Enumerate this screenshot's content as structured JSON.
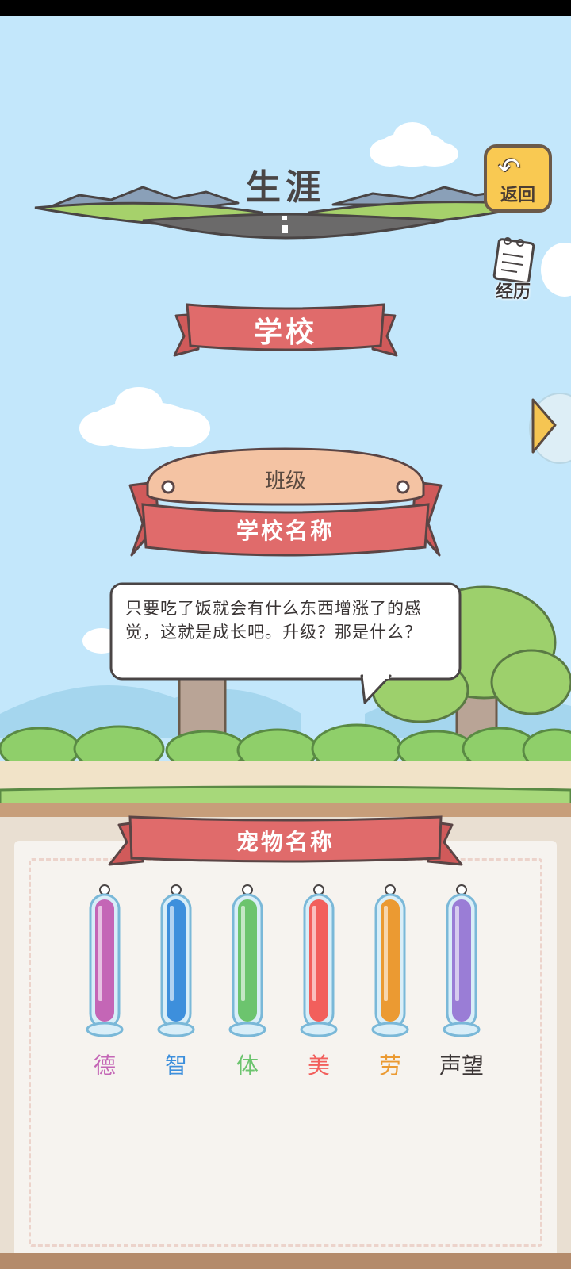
{
  "header": {
    "title": "生涯"
  },
  "back_button": {
    "label": "返回",
    "icon": "return-arrow-icon"
  },
  "history_button": {
    "label": "经历",
    "icon": "notebook-icon"
  },
  "school_banner": {
    "label": "学校"
  },
  "class_sign": {
    "plank_label": "班级",
    "ribbon_label": "学校名称"
  },
  "speech_bubble": {
    "text": "只要吃了饭就会有什么东西增涨了的感觉，这就是成长吧。升级？那是什么？"
  },
  "pet_panel": {
    "name_label": "宠物名称",
    "stats": [
      {
        "label": "德",
        "color": "#c466b6"
      },
      {
        "label": "智",
        "color": "#3d8fdc"
      },
      {
        "label": "体",
        "color": "#6cc46e"
      },
      {
        "label": "美",
        "color": "#f25f5c"
      },
      {
        "label": "劳",
        "color": "#eb9a32"
      },
      {
        "label": "声望",
        "color": "#9a7dd6"
      }
    ]
  },
  "colors": {
    "ribbon": "#e06b6b",
    "sky": "#c3e7fb",
    "back_button": "#f9c952"
  }
}
